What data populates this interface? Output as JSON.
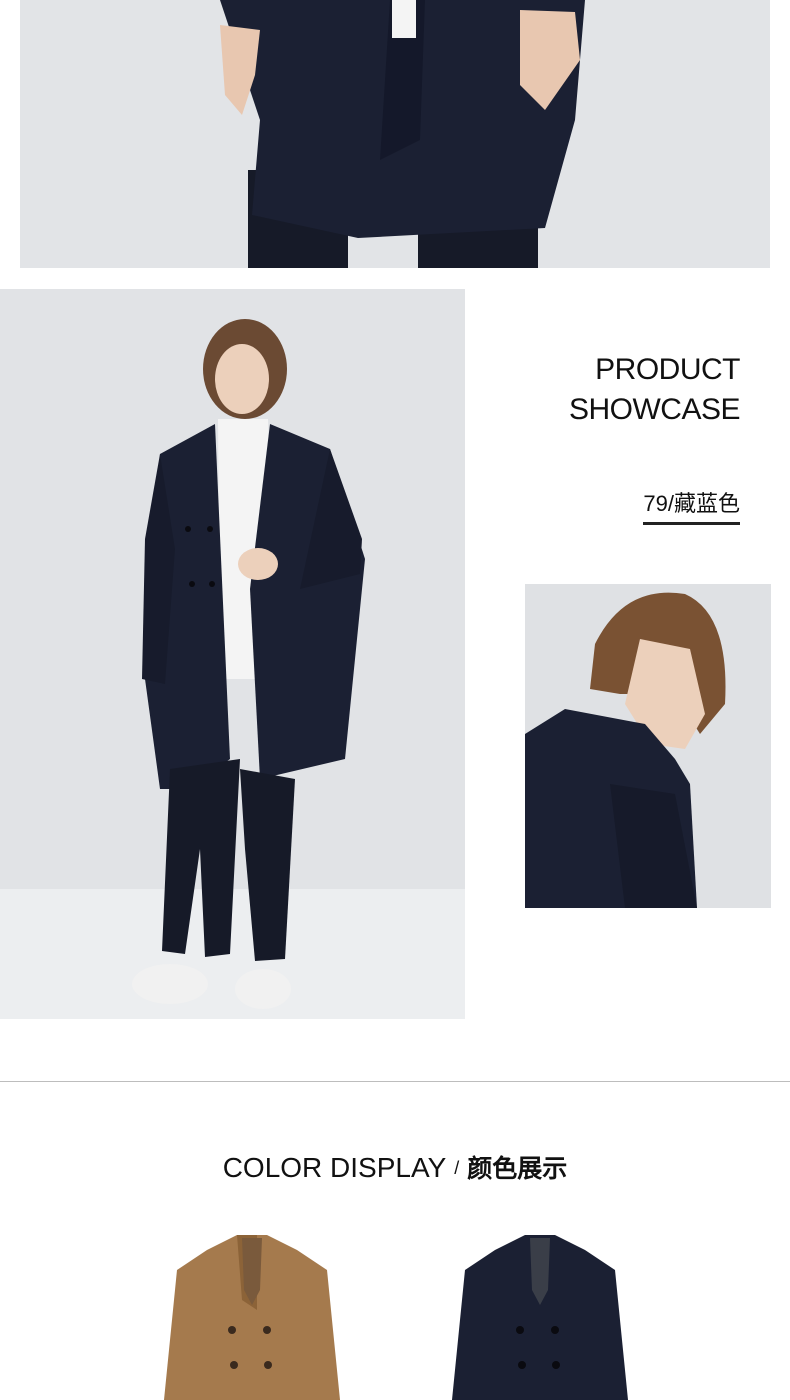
{
  "showcase": {
    "title": "PRODUCT\nSHOWCASE",
    "color_code": "79/藏蓝色"
  },
  "color_display": {
    "title_en": "COLOR DISPLAY",
    "separator": "/",
    "title_cn": "颜色展示"
  },
  "colors": {
    "coat_navy": "#1b2033",
    "coat_camel": "#a57a4d",
    "background": "#e2e4e7",
    "underline": "#222222"
  }
}
